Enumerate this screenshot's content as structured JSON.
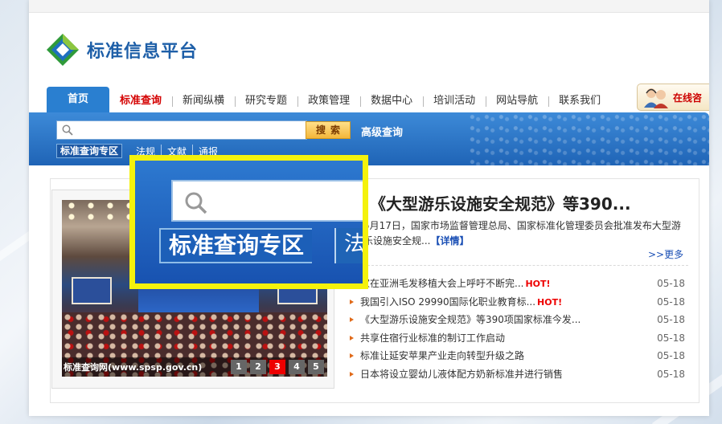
{
  "site": {
    "name": "标准信息平台"
  },
  "nav": {
    "items": [
      "首页",
      "标准查询",
      "新闻纵横",
      "研究专题",
      "政策管理",
      "数据中心",
      "培训活动",
      "网站导航",
      "联系我们"
    ]
  },
  "online_consult": "在线咨",
  "search": {
    "placeholder": "",
    "button_label": "搜索",
    "advanced_label": "高级查询",
    "zone_label": "标准查询专区",
    "zone_links": [
      "法规",
      "文献",
      "通报"
    ]
  },
  "callout": {
    "zone_label": "标准查询专区",
    "next_partial": "法"
  },
  "slider": {
    "caption": "标准查询网(www.spsp.gov.cn)",
    "pages": [
      "1",
      "2",
      "3",
      "4",
      "5"
    ],
    "active_page": "3"
  },
  "featured": {
    "headline": "《大型游乐设施安全规范》等390...",
    "summary": "5月17日，国家市场监督管理总局、国家标准化管理委员会批准发布大型游乐设施安全规...",
    "detail_link": "【详情】",
    "more_link": ">>更多"
  },
  "news": [
    {
      "title": "家在亚洲毛发移植大会上呼吁不断完...",
      "hot": "HOT!",
      "date": "05-18"
    },
    {
      "title": "我国引入ISO 29990国际化职业教育标...",
      "hot": "HOT!",
      "date": "05-18"
    },
    {
      "title": "《大型游乐设施安全规范》等390项国家标准今发...",
      "hot": "",
      "date": "05-18"
    },
    {
      "title": "共享住宿行业标准的制订工作启动",
      "hot": "",
      "date": "05-18"
    },
    {
      "title": "标准让延安苹果产业走向转型升级之路",
      "hot": "",
      "date": "05-18"
    },
    {
      "title": "日本将设立婴幼儿液体配方奶新标准并进行销售",
      "hot": "",
      "date": "05-18"
    }
  ],
  "colors": {
    "brand_blue": "#1e5fa8",
    "nav_active": "#2a7fd0",
    "highlight_yellow": "#f4f20c",
    "hot_red": "#e00000"
  }
}
